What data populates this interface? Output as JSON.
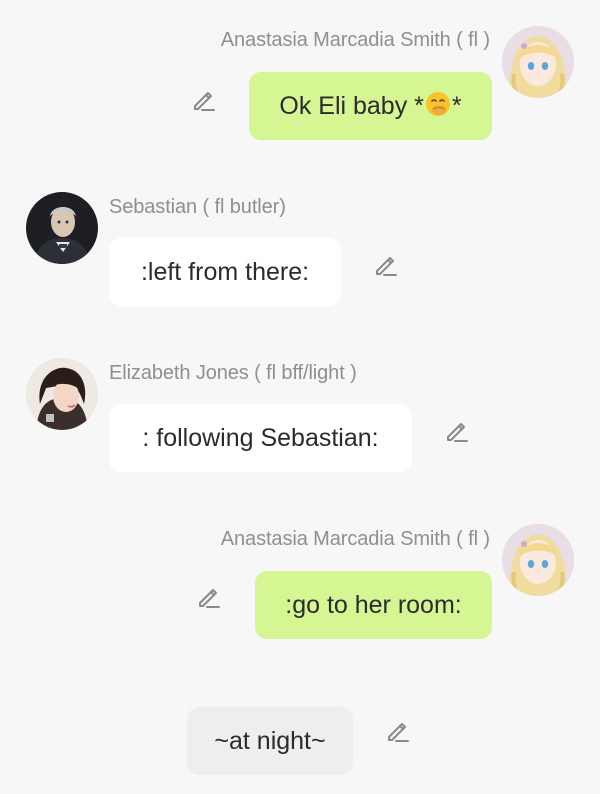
{
  "messages": [
    {
      "sender": "Anastasia Marcadia Smith ( fl )",
      "text_before": "Ok Eli baby *",
      "emoji": "hand-over-mouth-emoji",
      "text_after": "*",
      "side": "right",
      "avatar": "anastasia-avatar"
    },
    {
      "sender": "Sebastian ( fl butler)",
      "text": ":left from there:",
      "side": "left",
      "avatar": "sebastian-avatar"
    },
    {
      "sender": "Elizabeth Jones ( fl bff/light )",
      "text": ": following Sebastian:",
      "side": "left",
      "avatar": "elizabeth-avatar"
    },
    {
      "sender": "Anastasia Marcadia Smith ( fl )",
      "text": ":go to her room:",
      "side": "right",
      "avatar": "anastasia-avatar"
    },
    {
      "text": "~at night~",
      "side": "center",
      "kind": "narration"
    }
  ],
  "icons": {
    "edit": "pencil-edit-icon"
  },
  "colors": {
    "background": "#f7f7f7",
    "sent_bubble": "#d6f593",
    "received_bubble": "#ffffff",
    "narration_bubble": "#eeeeee",
    "sender_name": "#8f8f8f",
    "message_text": "#2b2b2b",
    "edit_icon": "#8a8a8a"
  }
}
